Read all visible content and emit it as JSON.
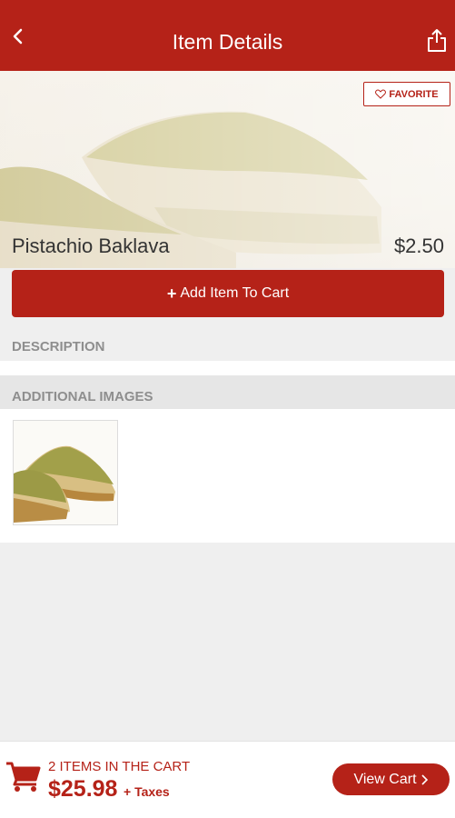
{
  "header": {
    "title": "Item Details",
    "back_icon": "chevron-left-icon",
    "share_icon": "share-icon"
  },
  "item": {
    "name": "Pistachio Baklava",
    "price": "$2.50",
    "favorite_label": "FAVORITE",
    "add_to_cart_label": "Add Item To Cart"
  },
  "sections": {
    "description_title": "DESCRIPTION",
    "additional_images_title": "ADDITIONAL IMAGES"
  },
  "cart": {
    "count_label": "2 ITEMS IN THE CART",
    "total": "$25.98",
    "taxes_label": "+ Taxes",
    "view_cart_label": "View Cart"
  },
  "colors": {
    "brand": "#b52218",
    "section_header_text": "#8e8e8e"
  }
}
